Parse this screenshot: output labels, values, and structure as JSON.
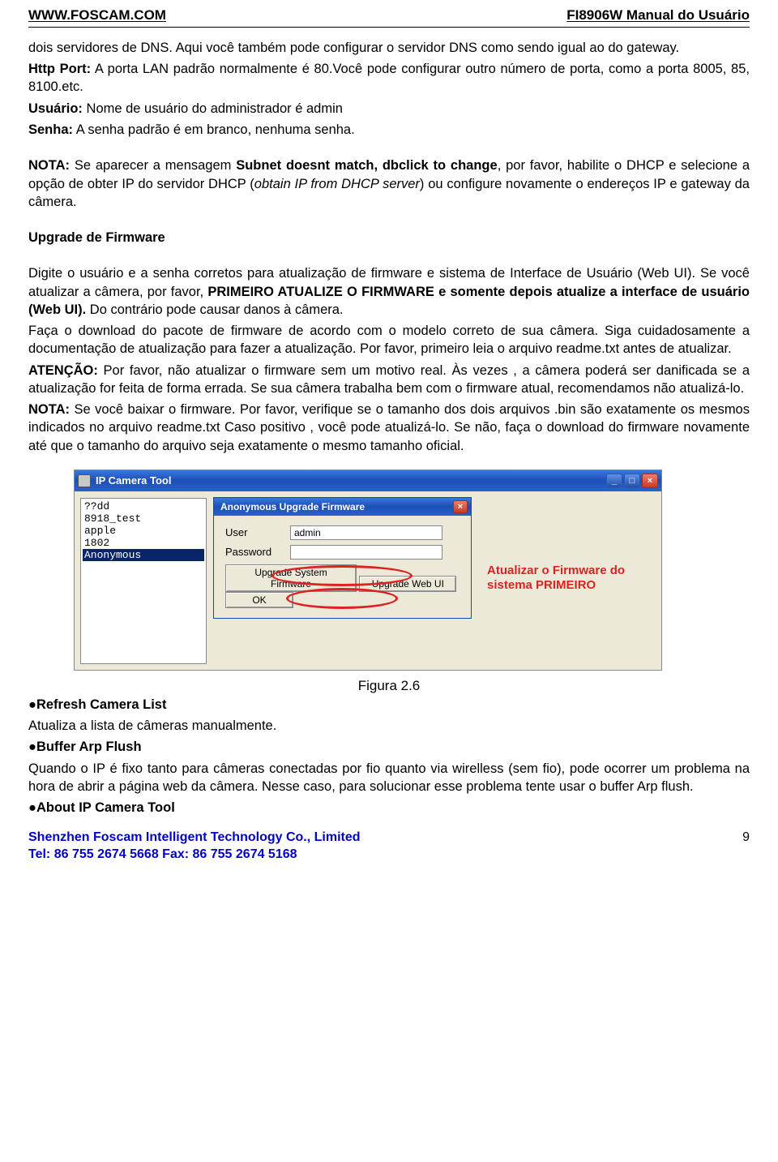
{
  "header": {
    "left": "WWW.FOSCAM.COM",
    "right": "FI8906W Manual do Usuário"
  },
  "p1": {
    "l1": "dois servidores de DNS. Aqui você também pode configurar o servidor DNS   como sendo igual ao do gateway.",
    "http_port_label": "Http Port:",
    "http_port_text": " A porta LAN padrão normalmente é 80.Você pode configurar outro número de porta, como a porta 8005, 85, 8100.etc.",
    "usuario_label": "Usuário:",
    "usuario_text": " Nome de usuário do administrador é admin",
    "senha_label": "Senha:",
    "senha_text": " A senha padrão é em branco, nenhuma senha."
  },
  "nota": {
    "label": "NOTA:",
    "pre": " Se aparecer a mensagem ",
    "msg": "Subnet doesnt match, dbclick to change",
    "mid1": ", por favor, habilite o DHCP e selecione a opção de obter IP do servidor DHCP (",
    "italic": "obtain IP from DHCP server",
    "mid2": ") ou configure novamente o endereços IP e gateway da câmera."
  },
  "upgrade": {
    "title": "Upgrade de Firmware",
    "l1a": "Digite o usuário e a senha corretos para atualização de firmware e sistema de Interface de Usuário (Web UI).  Se  você  atualizar  a  câmera,  por  favor,  ",
    "l1b": "PRIMEIRO ATUALIZE O FIRMWARE e somente depois   atualize a interface de usuário (Web UI).",
    "l1c": "   Do contrário pode causar danos à câmera.",
    "l2": "Faça o download do pacote de firmware de acordo com o modelo correto de sua câmera. Siga cuidadosamente a documentação de atualização para fazer a atualização. Por favor, primeiro leia o arquivo readme.txt antes de atualizar.",
    "atencao_label": "ATENÇÃO:",
    "atencao_text": " Por favor, não atualizar o firmware sem um motivo real. Às vezes , a câmera poderá ser danificada se a atualização for feita de forma errada. Se sua câmera trabalha bem com o firmware atual, recomendamos não atualizá-lo.",
    "nota2_label": "NOTA:",
    "nota2_text": " Se você baixar o firmware. Por favor, verifique se o tamanho dos dois arquivos .bin são exatamente os mesmos indicados no arquivo readme.txt   Caso positivo , você pode atualizá-lo. Se não, faça o download do firmware novamente até que o tamanho do arquivo seja exatamente o mesmo tamanho oficial."
  },
  "screenshot": {
    "outer_title": "IP Camera Tool",
    "list": [
      "??dd",
      "8918_test",
      "apple",
      "1802",
      "Anonymous"
    ],
    "selected_index": 4,
    "inner_title": "Anonymous Upgrade Firmware",
    "user_label": "User",
    "user_value": "admin",
    "password_label": "Password",
    "password_value": "",
    "btn_upgrade_sys": "Upgrade System Firmware",
    "btn_upgrade_web": "Upgrade Web UI",
    "btn_ok": "OK",
    "annotation_line1": "Atualizar o Firmware do",
    "annotation_line2": "sistema PRIMEIRO"
  },
  "figure_label": "Figura 2.6",
  "refresh": {
    "title": "●Refresh Camera List",
    "text": "Atualiza a lista de câmeras manualmente."
  },
  "buffer": {
    "title": "●Buffer Arp Flush",
    "text": "Quando o IP é fixo tanto para câmeras conectadas por fio quanto via wirelless (sem fio), pode ocorrer um problema na hora de abrir a página web da câmera. Nesse caso, para solucionar esse problema tente usar o buffer Arp flush."
  },
  "about_title": "●About IP Camera Tool",
  "footer": {
    "company": "Shenzhen Foscam Intelligent Technology Co., Limited",
    "tel": "Tel: 86 755 2674 5668 Fax: 86 755 2674 5168",
    "page": "9"
  }
}
